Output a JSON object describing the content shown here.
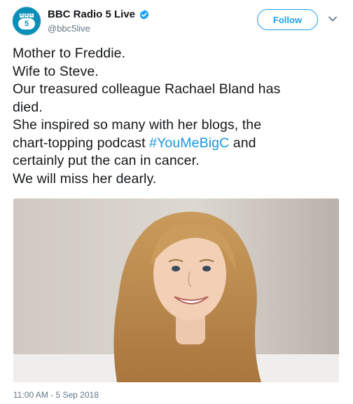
{
  "header": {
    "display_name": "BBC Radio 5 Live",
    "handle": "@bbc5live",
    "follow_label": "Follow",
    "avatar": {
      "logo_letters": [
        "B",
        "B",
        "C"
      ],
      "badge": "5",
      "color": "#0a8fb8"
    },
    "verified_icon": "verified-badge-icon",
    "menu_icon": "chevron-down-icon"
  },
  "tweet": {
    "lines": [
      "Mother to Freddie.",
      "Wife to Steve.",
      "Our treasured colleague Rachael Bland has",
      "died.",
      "She inspired so many with her blogs, the",
      {
        "before": "chart-topping podcast ",
        "hashtag": "#YouMeBigC",
        "after": " and"
      },
      "certainly put the can in cancer.",
      "We will miss her dearly."
    ]
  },
  "media": {
    "icon": "photo-of-smiling-woman"
  },
  "footer": {
    "timestamp": "11:00 AM - 5 Sep 2018"
  },
  "colors": {
    "accent": "#1da1f2",
    "hashtag": "#1b95e0",
    "text": "#14171a",
    "secondary": "#657786"
  }
}
